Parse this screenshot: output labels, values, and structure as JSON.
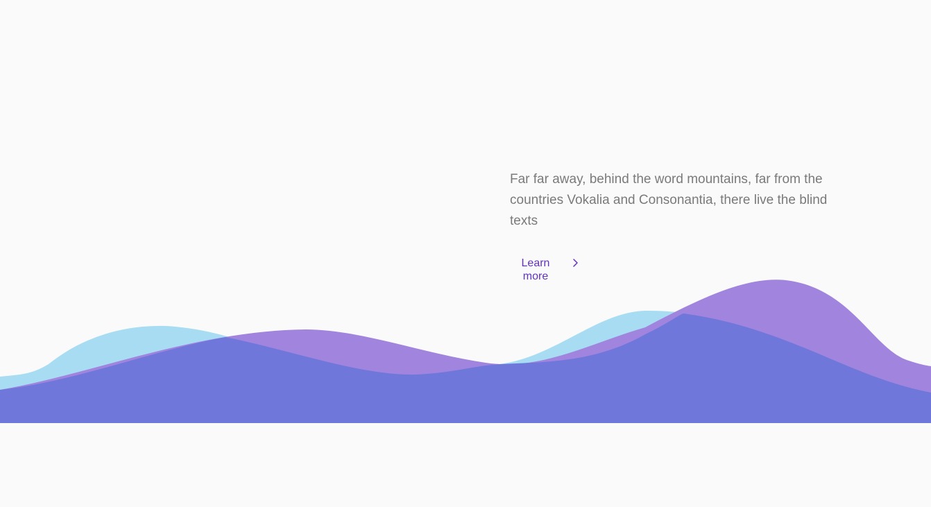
{
  "hero": {
    "text": "Far far away, behind the word mountains, far from the countries Vokalia and Consonantia, there live the blind texts"
  },
  "cta": {
    "label": "Learn more",
    "icon": "chevron-right-icon"
  },
  "colors": {
    "background": "#fafafa",
    "text": "#7a7a7a",
    "accent": "#6232c0",
    "wave_light_blue": "#a7dcf3",
    "wave_purple": "#a184de",
    "wave_indigo": "#6f77da"
  }
}
